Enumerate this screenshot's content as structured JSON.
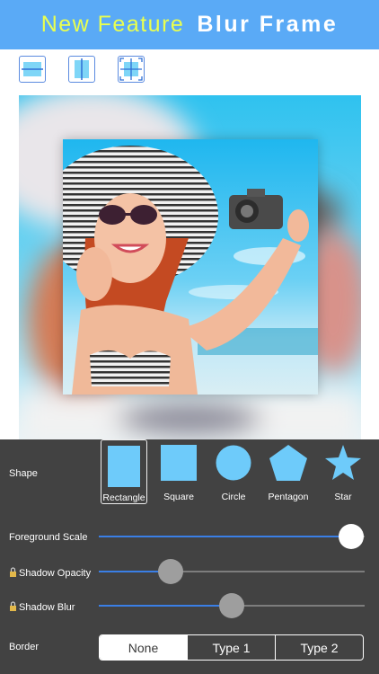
{
  "header": {
    "title_part1": "New Feature",
    "title_part2": "Blur Frame"
  },
  "layout_icons": [
    "layout-split-horizontal-icon",
    "layout-split-vertical-icon",
    "layout-grid-expand-icon"
  ],
  "panel": {
    "shape_label": "Shape",
    "shapes": [
      {
        "label": "Rectangle",
        "selected": true
      },
      {
        "label": "Square",
        "selected": false
      },
      {
        "label": "Circle",
        "selected": false
      },
      {
        "label": "Pentagon",
        "selected": false
      },
      {
        "label": "Star",
        "selected": false
      }
    ],
    "foreground_scale": {
      "label": "Foreground Scale",
      "value": 0.95
    },
    "shadow_opacity": {
      "label": "Shadow Opacity",
      "value": 0.27
    },
    "shadow_blur": {
      "label": "Shadow Blur",
      "value": 0.5
    },
    "border": {
      "label": "Border",
      "options": [
        "None",
        "Type 1",
        "Type 2"
      ],
      "selected": "None"
    }
  },
  "colors": {
    "header": "#5aaaf6",
    "title_yellow": "#e9ff4f",
    "panel": "#424242",
    "accent_blue": "#3a7fe6",
    "shape_fill": "#6ecbfa"
  }
}
